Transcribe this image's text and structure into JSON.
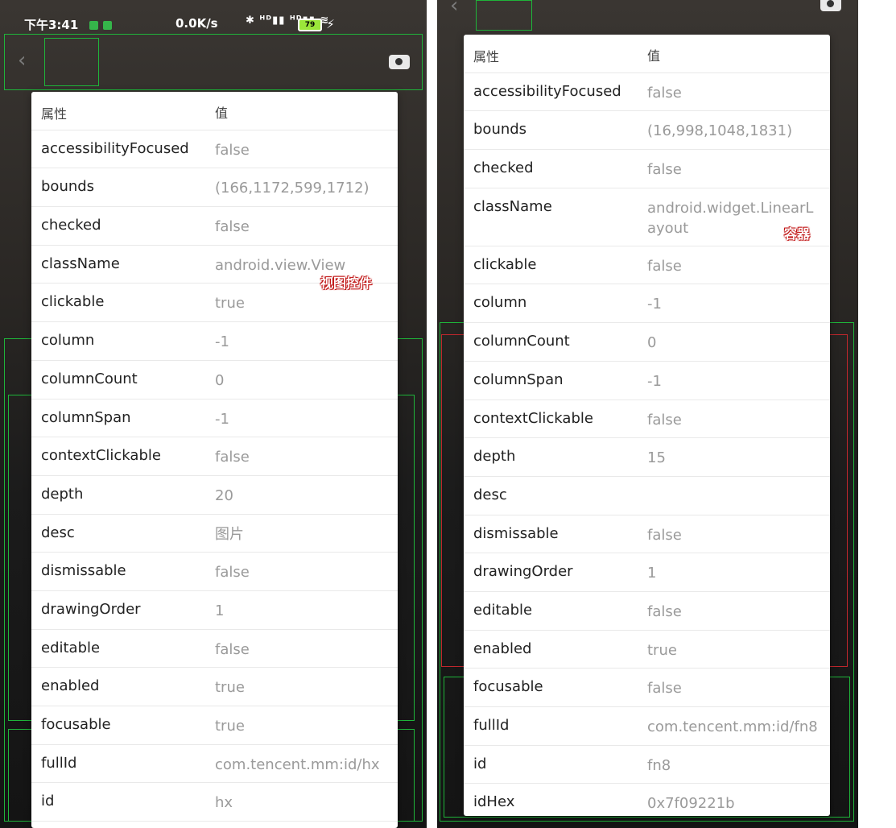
{
  "left": {
    "statusbar": {
      "time": "下午3:41",
      "net": "0.0K/s",
      "icons": "✱ ᴴᴰ▮▮ ᴴᴰ▮▮ ≋",
      "battery": "79"
    },
    "header": {
      "key": "属性",
      "value": "值"
    },
    "rows": [
      {
        "key": "accessibilityFocused",
        "value": "false"
      },
      {
        "key": "bounds",
        "value": "(166,1172,599,1712)"
      },
      {
        "key": "checked",
        "value": "false"
      },
      {
        "key": "className",
        "value": "android.view.View"
      },
      {
        "key": "clickable",
        "value": "true"
      },
      {
        "key": "column",
        "value": "-1"
      },
      {
        "key": "columnCount",
        "value": "0"
      },
      {
        "key": "columnSpan",
        "value": "-1"
      },
      {
        "key": "contextClickable",
        "value": "false"
      },
      {
        "key": "depth",
        "value": "20"
      },
      {
        "key": "desc",
        "value": "图片"
      },
      {
        "key": "dismissable",
        "value": "false"
      },
      {
        "key": "drawingOrder",
        "value": "1"
      },
      {
        "key": "editable",
        "value": "false"
      },
      {
        "key": "enabled",
        "value": "true"
      },
      {
        "key": "focusable",
        "value": "true"
      },
      {
        "key": "fullId",
        "value": "com.tencent.mm:id/hx"
      },
      {
        "key": "id",
        "value": "hx"
      }
    ],
    "annotation": "视图控件"
  },
  "right": {
    "header": {
      "key": "属性",
      "value": "值"
    },
    "rows": [
      {
        "key": "accessibilityFocused",
        "value": "false"
      },
      {
        "key": "bounds",
        "value": "(16,998,1048,1831)"
      },
      {
        "key": "checked",
        "value": "false"
      },
      {
        "key": "className",
        "value": "android.widget.LinearLayout"
      },
      {
        "key": "clickable",
        "value": "false"
      },
      {
        "key": "column",
        "value": "-1"
      },
      {
        "key": "columnCount",
        "value": "0"
      },
      {
        "key": "columnSpan",
        "value": "-1"
      },
      {
        "key": "contextClickable",
        "value": "false"
      },
      {
        "key": "depth",
        "value": "15"
      },
      {
        "key": "desc",
        "value": ""
      },
      {
        "key": "dismissable",
        "value": "false"
      },
      {
        "key": "drawingOrder",
        "value": "1"
      },
      {
        "key": "editable",
        "value": "false"
      },
      {
        "key": "enabled",
        "value": "true"
      },
      {
        "key": "focusable",
        "value": "false"
      },
      {
        "key": "fullId",
        "value": "com.tencent.mm:id/fn8"
      },
      {
        "key": "id",
        "value": "fn8"
      },
      {
        "key": "idHex",
        "value": "0x7f09221b"
      }
    ],
    "annotation": "容器"
  },
  "colors": {
    "outline": "#1fb53a",
    "highlight": "#c0272d",
    "annotation_fill": "#ffffff",
    "annotation_stroke": "#c01616"
  }
}
